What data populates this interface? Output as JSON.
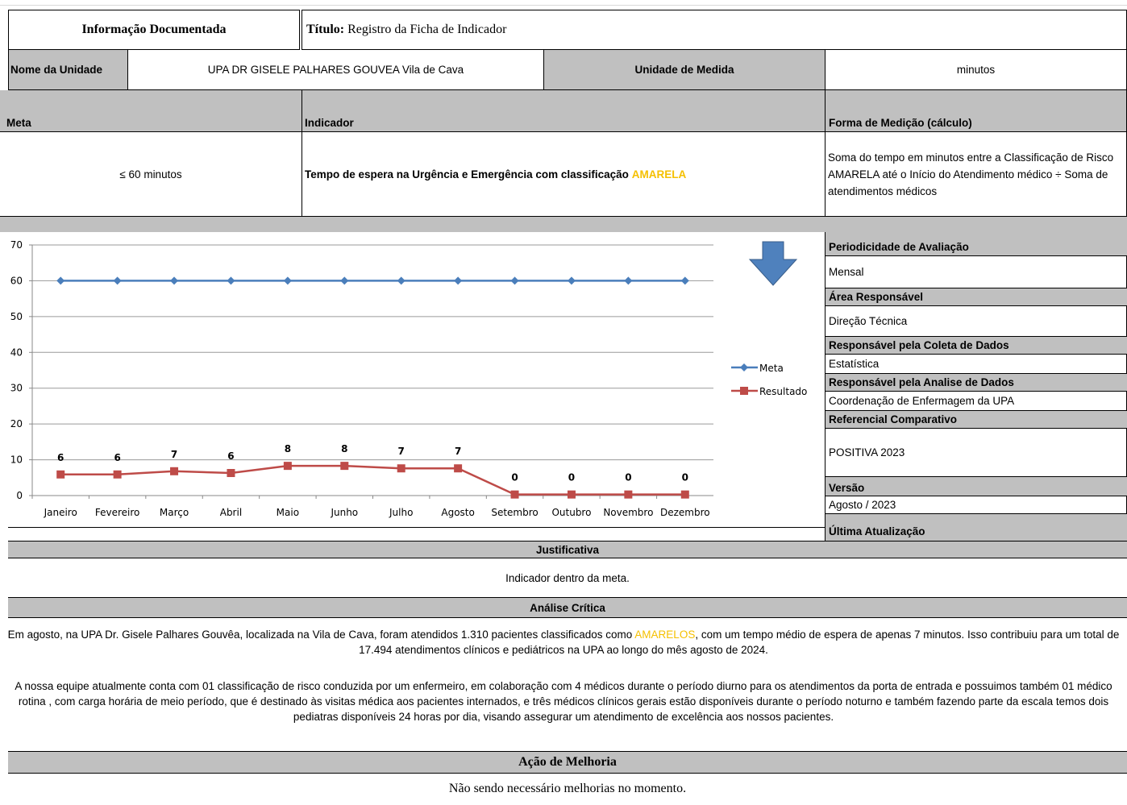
{
  "header": {
    "left_title": "Informação Documentada",
    "title_label": "Título:",
    "title_value": "Registro da Ficha de Indicador"
  },
  "unit": {
    "name_label": "Nome da Unidade",
    "name_value": "UPA DR GISELE PALHARES GOUVEA Vila de Cava",
    "measure_label": "Unidade de Medida",
    "measure_value": "minutos"
  },
  "meta_section": {
    "meta_label": "Meta",
    "meta_value": "≤ 60 minutos",
    "indicator_label": "Indicador",
    "indicator_text": "Tempo de espera na Urgência e Emergência com classificação ",
    "indicator_highlight": "AMARELA",
    "highlight_color": "#f5c000",
    "calc_label": "Forma de Medição (cálculo)",
    "calc_text": "Soma do tempo em minutos entre a Classificação de Risco AMARELA até o Início do Atendimento médico ÷ Soma de atendimentos médicos"
  },
  "right_panel": {
    "periodicidade_label": "Periodicidade de Avaliação",
    "periodicidade_value": "Mensal",
    "area_label": "Área Responsável",
    "area_value": "Direção Técnica",
    "coleta_label": "Responsável pela Coleta de Dados",
    "coleta_value": "Estatística",
    "analise_label": "Responsável pela Analise de Dados",
    "analise_value": "Coordenação de Enfermagem da UPA",
    "referencial_label": "Referencial Comparativo",
    "referencial_value": "POSITIVA 2023",
    "versao_label": "Versão",
    "versao_value": "Agosto / 2023",
    "atualizacao_label": "Última Atualização"
  },
  "chart_data": {
    "type": "line",
    "categories": [
      "Janeiro",
      "Fevereiro",
      "Março",
      "Abril",
      "Maio",
      "Junho",
      "Julho",
      "Agosto",
      "Setembro",
      "Outubro",
      "Novembro",
      "Dezembro"
    ],
    "series": [
      {
        "name": "Meta",
        "values": [
          60,
          60,
          60,
          60,
          60,
          60,
          60,
          60,
          60,
          60,
          60,
          60
        ],
        "color": "#4a7ebb",
        "marker": "diamond"
      },
      {
        "name": "Resultado",
        "values": [
          5.9,
          5.9,
          6.8,
          6.3,
          8.3,
          8.3,
          7.6,
          7.6,
          0.3,
          0.3,
          0.3,
          0.3
        ],
        "labels": [
          "6",
          "6",
          "7",
          "6",
          "8",
          "8",
          "7",
          "7",
          "0",
          "0",
          "0",
          "0"
        ],
        "color": "#be4b48",
        "marker": "square"
      }
    ],
    "yticks": [
      "0",
      "10",
      "20",
      "30",
      "40",
      "50",
      "60",
      "70"
    ],
    "ylim": [
      0,
      70
    ],
    "grid": true,
    "legend_position": "right",
    "arrow_color": "#4f81bd"
  },
  "justificativa": {
    "label": "Justificativa",
    "text": "Indicador dentro da meta."
  },
  "analise": {
    "label": "Análise Crítica",
    "p1_before": "Em agosto, na UPA Dr. Gisele Palhares Gouvêa, localizada na Vila de Cava, foram atendidos 1.310 pacientes classificados como ",
    "p1_highlight": "AMARELOS",
    "p1_after": ", com um tempo médio de espera de apenas 7 minutos. Isso contribuiu para um total de 17.494 atendimentos clínicos e pediátricos na UPA ao longo do mês agosto de 2024.",
    "p2": "A nossa equipe atualmente conta com 01 classificação de risco conduzida por um enfermeiro, em colaboração com 4 médicos durante o período diurno para os atendimentos da porta de entrada e possuimos também 01 médico rotina , com carga horária de meio período, que é destinado às visitas médica aos pacientes internados, e três médicos clínicos gerais estão disponíveis durante o período noturno e também fazendo parte da escala temos dois pediatras disponíveis 24 horas por dia, visando assegurar um atendimento de excelência aos nossos pacientes."
  },
  "melhoria": {
    "label": "Ação de Melhoria",
    "text": "Não sendo necessário melhorias no momento."
  }
}
